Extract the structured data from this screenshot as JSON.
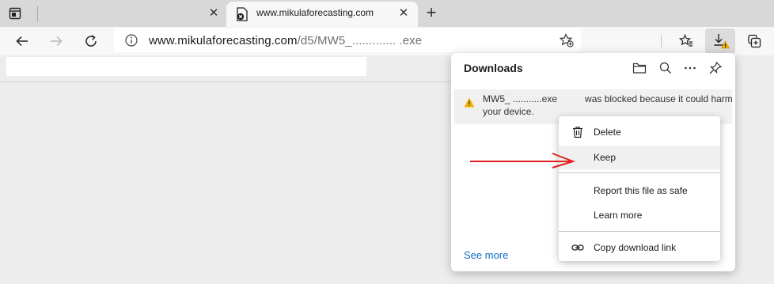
{
  "browser": {
    "active_tab_title": "www.mikulaforecasting.com",
    "url_host": "www.mikulaforecasting.com",
    "url_path": "/d5/MW5_............. .exe"
  },
  "downloads_panel": {
    "title": "Downloads",
    "item": {
      "filename": "MW5_ ...........exe",
      "message_part1": "was blocked because it could harm",
      "message_part2": "your device."
    },
    "see_more": "See more"
  },
  "context_menu": {
    "delete": "Delete",
    "keep": "Keep",
    "report": "Report this file as safe",
    "learn_more": "Learn more",
    "copy_link": "Copy download link"
  },
  "colors": {
    "accent_link": "#0f6cbd",
    "warning": "#f2b200",
    "annotation_arrow": "#e02020"
  },
  "icons": [
    "tab-actions-icon",
    "close-icon",
    "favicon-icon",
    "plus-icon",
    "back-icon",
    "forward-icon",
    "refresh-icon",
    "info-icon",
    "add-favorite-icon",
    "favorites-icon",
    "download-warning-icon",
    "collections-icon",
    "folder-icon",
    "search-icon",
    "more-icon",
    "pin-icon",
    "warning-icon",
    "trash-icon",
    "link-icon",
    "arrow-annotation-icon"
  ]
}
